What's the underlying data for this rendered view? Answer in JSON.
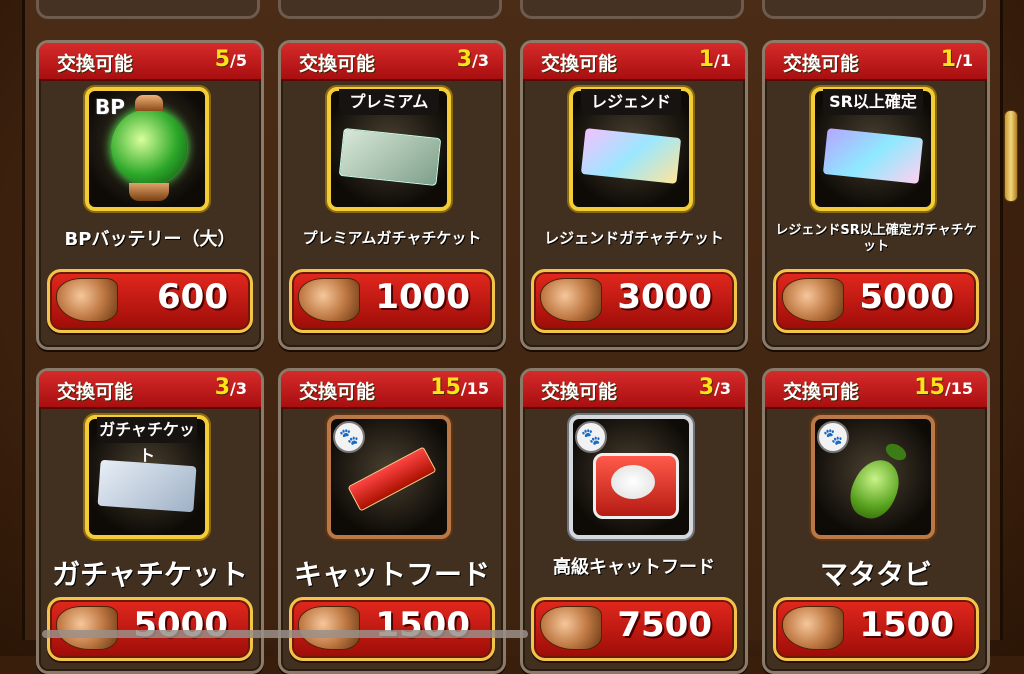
{
  "common": {
    "exchange_label": "交換可能"
  },
  "cards": [
    {
      "stock": "5",
      "max": "/5",
      "name": "BPバッテリー（大）",
      "price": "600",
      "badge": "BP",
      "icon": "bp-battery-icon"
    },
    {
      "stock": "3",
      "max": "/3",
      "name": "プレミアムガチャチケット",
      "price": "1000",
      "badge": "プレミアム",
      "icon": "premium-ticket-icon"
    },
    {
      "stock": "1",
      "max": "/1",
      "name": "レジェンドガチャチケット",
      "price": "3000",
      "badge": "レジェンド",
      "icon": "legend-ticket-icon"
    },
    {
      "stock": "1",
      "max": "/1",
      "name": "レジェンドSR以上確定ガチャチケット",
      "price": "5000",
      "badge": "SR以上確定",
      "icon": "sr-legend-ticket-icon"
    },
    {
      "stock": "3",
      "max": "/3",
      "name": "ガチャチケット",
      "price": "5000",
      "badge": "ガチャチケット",
      "icon": "gacha-ticket-icon"
    },
    {
      "stock": "15",
      "max": "/15",
      "name": "キャットフード",
      "price": "1500",
      "badge": "",
      "icon": "cat-food-icon"
    },
    {
      "stock": "3",
      "max": "/3",
      "name": "高級キャットフード",
      "price": "7500",
      "badge": "",
      "icon": "premium-cat-food-icon"
    },
    {
      "stock": "15",
      "max": "/15",
      "name": "マタタビ",
      "price": "1500",
      "badge": "",
      "icon": "matatabi-icon"
    }
  ],
  "colors": {
    "header_red": "#c81d1d",
    "count_yellow": "#ffe21a",
    "price_red": "#d0201a",
    "gold_border": "#f3cc36"
  }
}
